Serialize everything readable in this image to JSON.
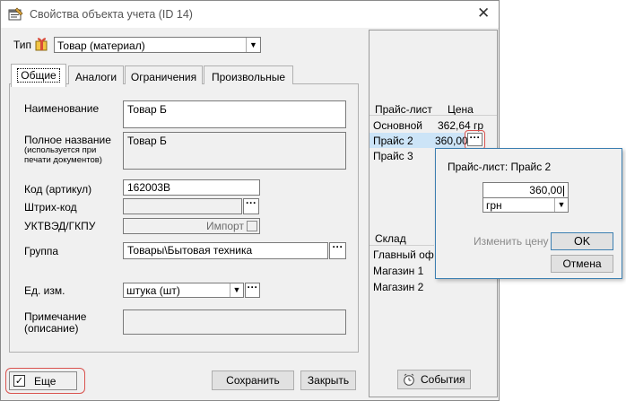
{
  "window": {
    "title": "Свойства объекта учета  (ID 14)"
  },
  "type": {
    "label": "Тип",
    "value": "Товар (материал)"
  },
  "tabs": [
    "Общие",
    "Аналоги",
    "Ограничения",
    "Произвольные"
  ],
  "form": {
    "name_label": "Наименование",
    "name_value": "Товар Б",
    "fullname_label": "Полное название",
    "fullname_hint": "(используется при печати документов)",
    "fullname_value": "Товар Б",
    "code_label": "Код (артикул)",
    "code_value": "162003B",
    "barcode_label": "Штрих-код",
    "barcode_value": "",
    "uktved_label": "УКТВЭД/ГКПУ",
    "import_label": "Импорт",
    "group_label": "Группа",
    "group_value": "Товары\\Бытовая техника",
    "unit_label": "Ед. изм.",
    "unit_value": "штука (шт)",
    "note_label": "Примечание (описание)",
    "note_value": ""
  },
  "footer": {
    "more_label": "Еще",
    "more_checked": true,
    "save_label": "Сохранить",
    "close_label": "Закрыть"
  },
  "price_table": {
    "headers": [
      "Прайс-лист",
      "Цена"
    ],
    "rows": [
      {
        "list": "Основной",
        "price": "362,64 гр"
      },
      {
        "list": "Прайс 2",
        "price": "360,00"
      },
      {
        "list": "Прайс 3",
        "price": ""
      }
    ]
  },
  "stock_table": {
    "header": "Склад",
    "rows": [
      "Главный оф",
      "Магазин 1",
      "Магазин 2"
    ]
  },
  "events_label": "События",
  "popup": {
    "title": "Прайс-лист: Прайс 2",
    "price_value": "360,00",
    "currency": "грн",
    "change_price_label": "Изменить цену",
    "ok_label": "OK",
    "cancel_label": "Отмена"
  },
  "colors": {
    "accent": "#3c7fb1",
    "selection": "#cce4f7",
    "highlight": "#d9534f"
  }
}
